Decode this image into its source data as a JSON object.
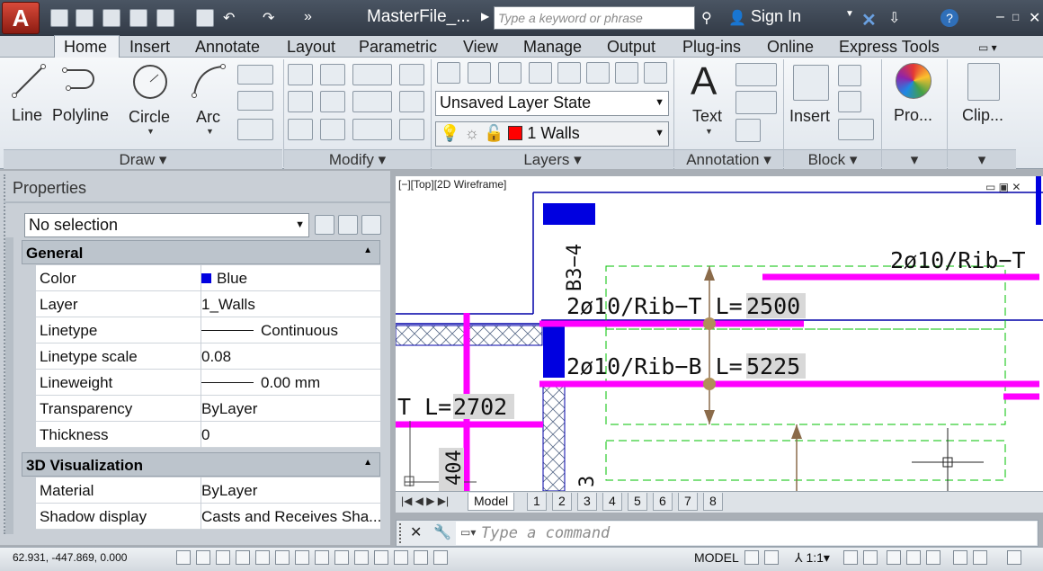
{
  "app": {
    "title": "MasterFile_...",
    "app_letter": "A"
  },
  "search": {
    "placeholder": "Type a keyword or phrase"
  },
  "account": {
    "sign_in": "Sign In"
  },
  "tabs": [
    "Home",
    "Insert",
    "Annotate",
    "Layout",
    "Parametric",
    "View",
    "Manage",
    "Output",
    "Plug-ins",
    "Online",
    "Express Tools"
  ],
  "ribbon": {
    "draw": {
      "line": "Line",
      "polyline": "Polyline",
      "circle": "Circle",
      "arc": "Arc",
      "panel": "Draw"
    },
    "modify": {
      "panel": "Modify"
    },
    "layers": {
      "state": "Unsaved Layer State",
      "current": "1  Walls",
      "panel": "Layers",
      "layer_color": "#ff0000"
    },
    "annotation": {
      "text": "Text",
      "panel": "Annotation"
    },
    "block": {
      "insert": "Insert",
      "panel": "Block"
    },
    "properties": {
      "label": "Pro..."
    },
    "clipboard": {
      "label": "Clip..."
    }
  },
  "properties": {
    "title": "Properties",
    "selection": "No selection",
    "general_header": "General",
    "general": [
      {
        "key": "Color",
        "value": "Blue"
      },
      {
        "key": "Layer",
        "value": "1_Walls"
      },
      {
        "key": "Linetype",
        "value": "Continuous"
      },
      {
        "key": "Linetype scale",
        "value": "0.08"
      },
      {
        "key": "Lineweight",
        "value": "0.00 mm"
      },
      {
        "key": "Transparency",
        "value": "ByLayer"
      },
      {
        "key": "Thickness",
        "value": "0"
      }
    ],
    "viz_header": "3D Visualization",
    "viz": [
      {
        "key": "Material",
        "value": "ByLayer"
      },
      {
        "key": "Shadow display",
        "value": "Casts and Receives Sha..."
      }
    ]
  },
  "viewport": {
    "label": "[−][Top][2D Wireframe]",
    "annotations": {
      "t1": "2ø10/Rib−T L=",
      "t1v": "2500",
      "t2": "2ø10/Rib−B L=",
      "t2v": "5225",
      "t3": "2ø10/Rib−T",
      "t4": "T L=",
      "t4v": "2702",
      "v1": "B3−4",
      "v2": "404",
      "v3": "3"
    }
  },
  "layout_tabs": [
    "Model",
    "1",
    "2",
    "3",
    "4",
    "5",
    "6",
    "7",
    "8"
  ],
  "command": {
    "placeholder": "Type a command"
  },
  "status": {
    "coords": "62.931, -447.869, 0.000",
    "model": "MODEL",
    "scale": "1:1"
  }
}
